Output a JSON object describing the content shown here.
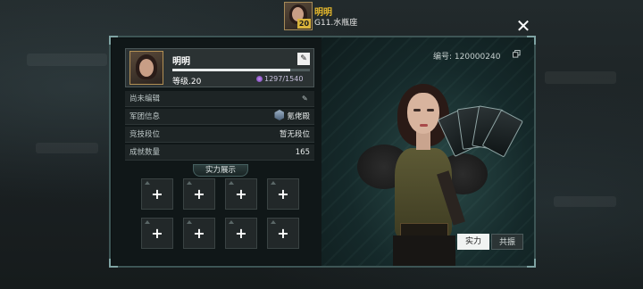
{
  "header": {
    "player_name": "明明",
    "level_badge": "20",
    "server": "G11.水瓶座",
    "close_icon": "✕"
  },
  "profile": {
    "name": "明明",
    "level": "等级.20",
    "xp_fraction": 0.86,
    "resource": "1297/1540",
    "id_label": "编号: 120000240"
  },
  "rows": {
    "signature": "尚未编辑",
    "guild_label": "军团信息",
    "guild_value": "氪佬殿",
    "rank_label": "竞技段位",
    "rank_value": "暂无段位",
    "achieve_label": "成就数量",
    "achieve_value": "165"
  },
  "showcase": {
    "title": "实力展示",
    "slot_symbol": "+",
    "slots": 8
  },
  "tabs": {
    "strength": "实力",
    "resonance": "共振"
  },
  "colors": {
    "gold": "#e6b92d",
    "panel_border": "#3d5555",
    "active_tab": "#f1f3f2"
  }
}
